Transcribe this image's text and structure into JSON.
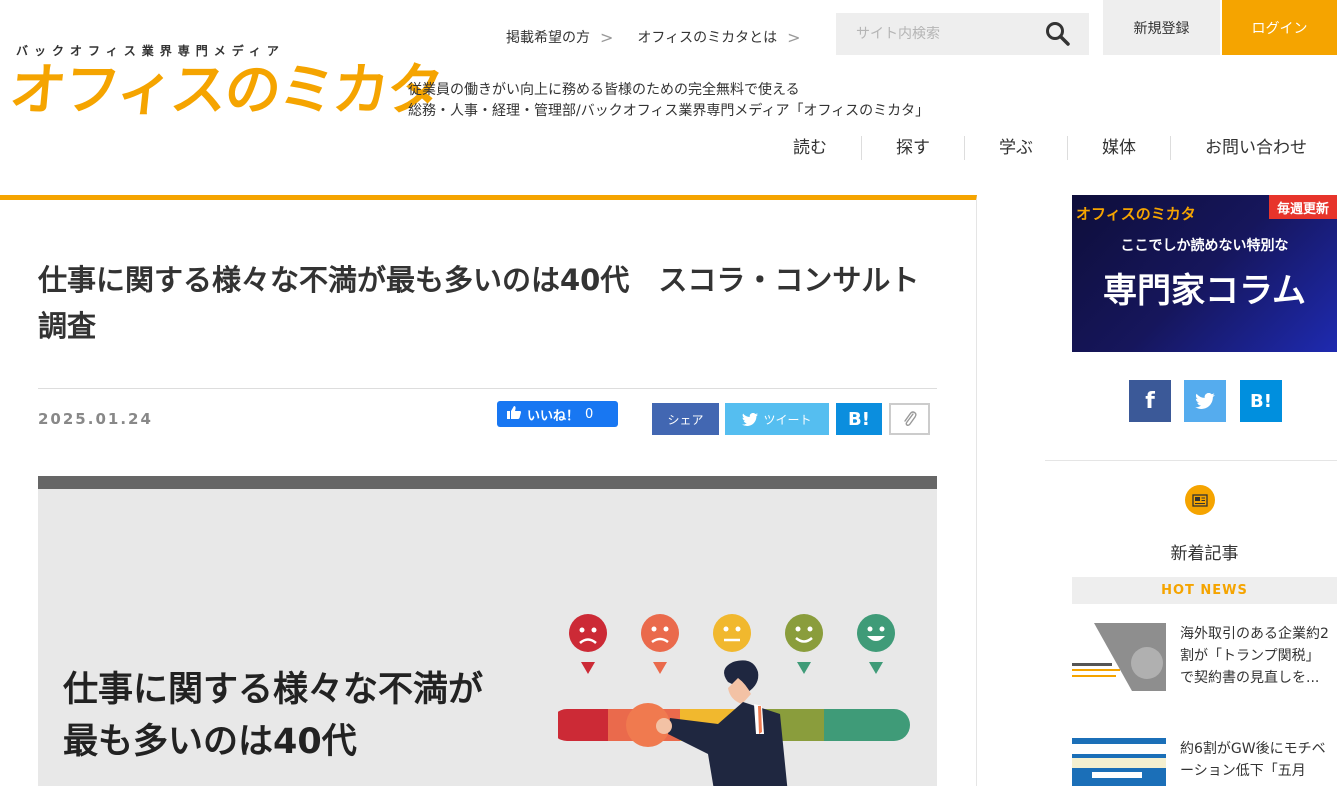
{
  "header": {
    "logo_tagline": "バックオフィス業界専門メディア",
    "logo_text": "オフィスのミカタ",
    "top_links": [
      {
        "label": "掲載希望の方",
        "chevron": ">"
      },
      {
        "label": "オフィスのミカタとは",
        "chevron": ">"
      }
    ],
    "search_placeholder": "サイト内検索",
    "register_label": "新規登録",
    "login_label": "ログイン",
    "description_line1": "従業員の働きがい向上に務める皆様のための完全無料で使える",
    "description_line2": "総務・人事・経理・管理部/バックオフィス業界専門メディア「オフィスのミカタ」",
    "nav": [
      "読む",
      "探す",
      "学ぶ",
      "媒体",
      "お問い合わせ"
    ]
  },
  "article": {
    "title": "仕事に関する様々な不満が最も多いのは40代　スコラ・コンサルト調査",
    "date": "2025.01.24",
    "fb_like_label": "いいね！",
    "fb_like_count": "0",
    "share_fb_label": "シェア",
    "share_tw_label": "ツイート",
    "share_hb_label": "B!",
    "hero_line1": "仕事に関する様々な不満が",
    "hero_line2": "最も多いのは40代"
  },
  "sidebar": {
    "banner_logo": "オフィスのミカタ",
    "banner_badge": "毎週更新",
    "banner_sub": "ここでしか読めない特別な",
    "banner_main": "専門家コラム",
    "news_heading": "新着記事",
    "hot_news_label": "HOT NEWS",
    "news_items": [
      {
        "title_line1": "海外取引のある企業約2",
        "title_line2": "割が「トランプ関税」",
        "title_line3": "で契約書の見直しを..."
      },
      {
        "title_line1": "約6割がGW後にモチベ",
        "title_line2": "ーション低下「五月",
        "title_line3": ""
      }
    ]
  },
  "colors": {
    "accent": "#f5a400",
    "facebook": "#4267b2",
    "twitter": "#55bef0",
    "hatena": "#0b8ede"
  }
}
